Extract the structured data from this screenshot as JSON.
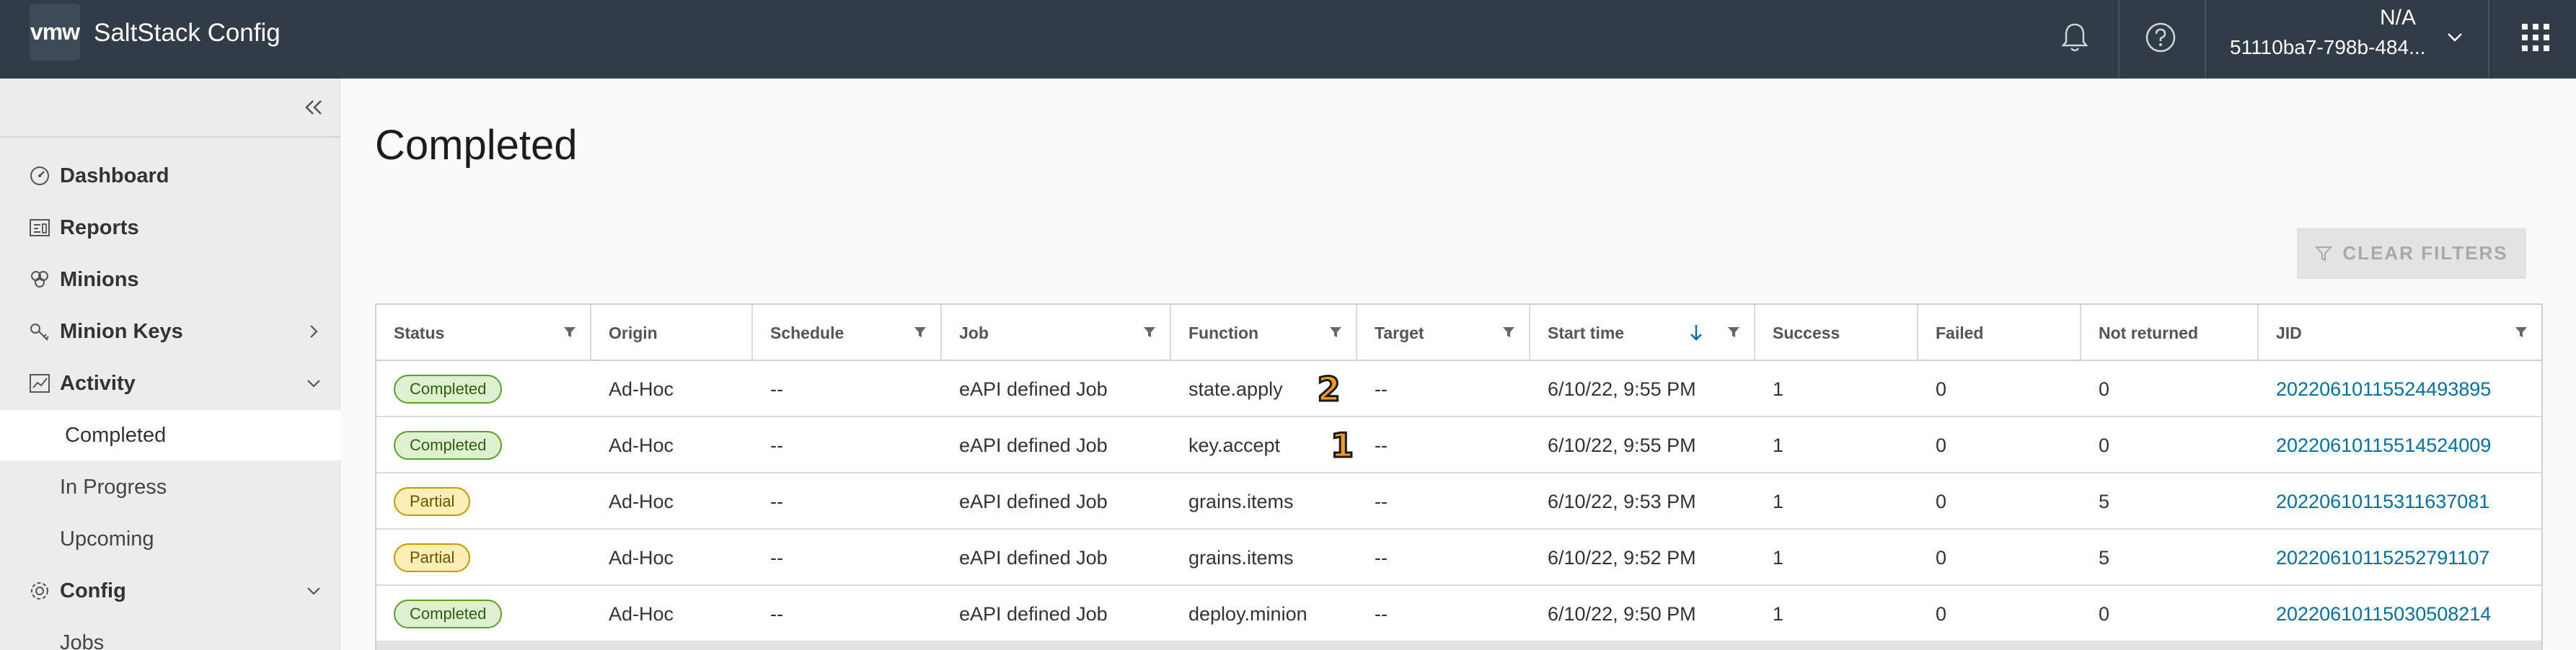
{
  "header": {
    "logo": "vmw",
    "title": "SaltStack Config",
    "user_name": "N/A",
    "user_id": "51110ba7-798b-484...",
    "icons": [
      "bell-icon",
      "help-icon",
      "chevron-down-icon",
      "app-grid-icon"
    ]
  },
  "sidebar": {
    "items": [
      {
        "label": "Dashboard",
        "icon": "dashboard-icon"
      },
      {
        "label": "Reports",
        "icon": "reports-icon"
      },
      {
        "label": "Minions",
        "icon": "minions-icon"
      },
      {
        "label": "Minion Keys",
        "icon": "key-icon"
      },
      {
        "label": "Activity",
        "icon": "activity-icon"
      },
      {
        "label": "Config",
        "icon": "gear-icon"
      }
    ],
    "activity_sub": [
      "Completed",
      "In Progress",
      "Upcoming"
    ],
    "config_sub": [
      "Jobs"
    ]
  },
  "main": {
    "title": "Completed",
    "clear_filters": "CLEAR FILTERS"
  },
  "table": {
    "columns": [
      "Status",
      "Origin",
      "Schedule",
      "Job",
      "Function",
      "Target",
      "Start time",
      "Success",
      "Failed",
      "Not returned",
      "JID"
    ],
    "rows": [
      {
        "status": "Completed",
        "origin": "Ad-Hoc",
        "schedule": "--",
        "job": "eAPI defined Job",
        "function": "state.apply",
        "annotation": "2",
        "target": "--",
        "start": "6/10/22, 9:55 PM",
        "success": "1",
        "failed": "0",
        "not_returned": "0",
        "jid": "20220610115524493895"
      },
      {
        "status": "Completed",
        "origin": "Ad-Hoc",
        "schedule": "--",
        "job": "eAPI defined Job",
        "function": "key.accept",
        "annotation": "1",
        "target": "--",
        "start": "6/10/22, 9:55 PM",
        "success": "1",
        "failed": "0",
        "not_returned": "0",
        "jid": "20220610115514524009"
      },
      {
        "status": "Partial",
        "origin": "Ad-Hoc",
        "schedule": "--",
        "job": "eAPI defined Job",
        "function": "grains.items",
        "annotation": "",
        "target": "--",
        "start": "6/10/22, 9:53 PM",
        "success": "1",
        "failed": "0",
        "not_returned": "5",
        "jid": "20220610115311637081"
      },
      {
        "status": "Partial",
        "origin": "Ad-Hoc",
        "schedule": "--",
        "job": "eAPI defined Job",
        "function": "grains.items",
        "annotation": "",
        "target": "--",
        "start": "6/10/22, 9:52 PM",
        "success": "1",
        "failed": "0",
        "not_returned": "5",
        "jid": "20220610115252791107"
      },
      {
        "status": "Completed",
        "origin": "Ad-Hoc",
        "schedule": "--",
        "job": "eAPI defined Job",
        "function": "deploy.minion",
        "annotation": "",
        "target": "--",
        "start": "6/10/22, 9:50 PM",
        "success": "1",
        "failed": "0",
        "not_returned": "0",
        "jid": "20220610115030508214"
      }
    ]
  },
  "colors": {
    "header_bg": "#313c47",
    "sidebar_bg": "#ececec",
    "completed_bg": "#dff0d0",
    "completed_border": "#5aa220",
    "partial_bg": "#fdeeb5",
    "partial_border": "#c79a00",
    "link": "#0072a3"
  }
}
